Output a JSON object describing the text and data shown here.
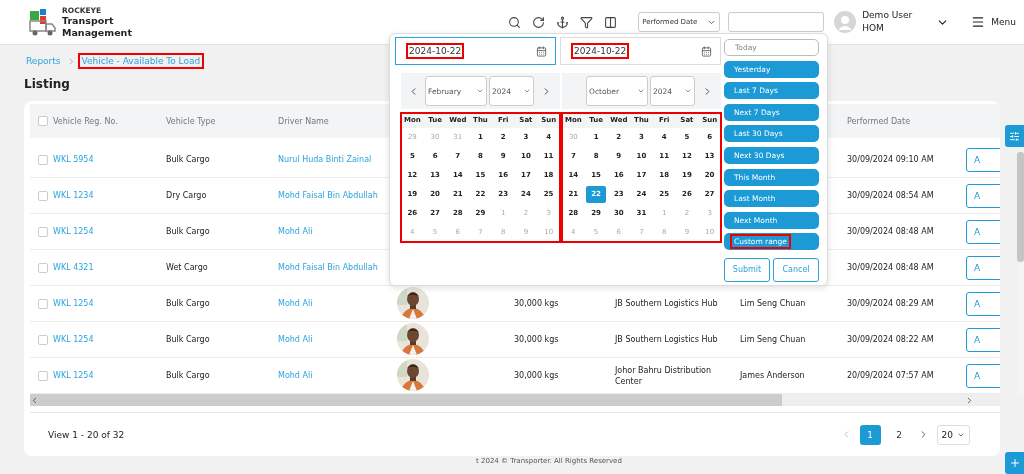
{
  "header": {
    "brand_small": "ROCKEYE",
    "brand": "Transport Management",
    "date_select": "Performed Date",
    "user": {
      "name": "Demo User",
      "role": "HOM"
    },
    "menu_label": "Menu"
  },
  "breadcrumb": [
    {
      "label": "Reports",
      "highlighted": false
    },
    {
      "label": "Vehicle - Available To Load",
      "highlighted": true
    }
  ],
  "page_title": "Listing",
  "table": {
    "select_all_checked": false,
    "header": {
      "reg": "Vehicle Reg. No.",
      "type": "Vehicle Type",
      "driver": "Driver Name",
      "performed_date": "Performed Date"
    },
    "rows": [
      {
        "checked": false,
        "reg": "WKL 5954",
        "type": "Bulk Cargo",
        "driver": "Nurul Huda Binti Zainal",
        "performed_date": "30/09/2024 09:10 AM",
        "action": "A"
      },
      {
        "checked": false,
        "reg": "WKL 1234",
        "type": "Dry Cargo",
        "driver": "Mohd Faisal Bin Abdullah",
        "performed_date": "30/09/2024 08:54 AM",
        "action": "A"
      },
      {
        "checked": false,
        "reg": "WKL 1254",
        "type": "Bulk Cargo",
        "driver": "Mohd Ali",
        "performed_date": "30/09/2024 08:48 AM",
        "action": "A"
      },
      {
        "checked": false,
        "reg": "WKL 4321",
        "type": "Wet Cargo",
        "driver": "Mohd Faisal Bin Abdullah",
        "performed_date": "30/09/2024 08:48 AM",
        "action": "A"
      },
      {
        "checked": false,
        "reg": "WKL 1254",
        "type": "Bulk Cargo",
        "driver": "Mohd Ali",
        "weight": "30,000 kgs",
        "location": "JB Southern Logistics Hub",
        "person": "Lim Seng Chuan",
        "performed_date": "30/09/2024 08:29 AM",
        "action": "A"
      },
      {
        "checked": false,
        "reg": "WKL 1254",
        "type": "Bulk Cargo",
        "driver": "Mohd Ali",
        "weight": "30,000 kgs",
        "location": "JB Southern Logistics Hub",
        "person": "Lim Seng Chuan",
        "performed_date": "30/09/2024 08:22 AM",
        "action": "A"
      },
      {
        "checked": false,
        "reg": "WKL 1254",
        "type": "Bulk Cargo",
        "driver": "Mohd Ali",
        "weight": "30,000 kgs",
        "location": "Johor Bahru Distribution Center",
        "person": "James Anderson",
        "performed_date": "20/09/2024 07:57 AM",
        "action": "A"
      }
    ]
  },
  "footer": {
    "view_text": "View 1 - 20 of 32",
    "pages": [
      {
        "label": "1",
        "selected": true
      },
      {
        "label": "2",
        "selected": false
      }
    ],
    "page_size": "20"
  },
  "copyright": "t 2024 © Transporter. All Rights Reserved",
  "date_picker": {
    "start_date": {
      "value": "2024-10-22",
      "focused": true,
      "highlighted": true
    },
    "end_date": {
      "value": "2024-10-22",
      "focused": false,
      "highlighted": true
    },
    "calendars": [
      {
        "month": "February",
        "year": "2024",
        "show_prev": true,
        "highlighted": true,
        "weekdays": [
          "Mon",
          "Tue",
          "Wed",
          "Thu",
          "Fri",
          "Sat",
          "Sun"
        ],
        "weeks": [
          [
            {
              "label": "29",
              "other_month": true,
              "selected": false
            },
            {
              "label": "30",
              "other_month": true,
              "selected": false
            },
            {
              "label": "31",
              "other_month": true,
              "selected": false
            },
            {
              "label": "1",
              "other_month": false,
              "selected": false
            },
            {
              "label": "2",
              "other_month": false,
              "selected": false
            },
            {
              "label": "3",
              "other_month": false,
              "selected": false
            },
            {
              "label": "4",
              "other_month": false,
              "selected": false
            }
          ],
          [
            {
              "label": "5",
              "other_month": false,
              "selected": false
            },
            {
              "label": "6",
              "other_month": false,
              "selected": false
            },
            {
              "label": "7",
              "other_month": false,
              "selected": false
            },
            {
              "label": "8",
              "other_month": false,
              "selected": false
            },
            {
              "label": "9",
              "other_month": false,
              "selected": false
            },
            {
              "label": "10",
              "other_month": false,
              "selected": false
            },
            {
              "label": "11",
              "other_month": false,
              "selected": false
            }
          ],
          [
            {
              "label": "12",
              "other_month": false,
              "selected": false
            },
            {
              "label": "13",
              "other_month": false,
              "selected": false
            },
            {
              "label": "14",
              "other_month": false,
              "selected": false
            },
            {
              "label": "15",
              "other_month": false,
              "selected": false
            },
            {
              "label": "16",
              "other_month": false,
              "selected": false
            },
            {
              "label": "17",
              "other_month": false,
              "selected": false
            },
            {
              "label": "18",
              "other_month": false,
              "selected": false
            }
          ],
          [
            {
              "label": "19",
              "other_month": false,
              "selected": false
            },
            {
              "label": "20",
              "other_month": false,
              "selected": false
            },
            {
              "label": "21",
              "other_month": false,
              "selected": false
            },
            {
              "label": "22",
              "other_month": false,
              "selected": false
            },
            {
              "label": "23",
              "other_month": false,
              "selected": false
            },
            {
              "label": "24",
              "other_month": false,
              "selected": false
            },
            {
              "label": "25",
              "other_month": false,
              "selected": false
            }
          ],
          [
            {
              "label": "26",
              "other_month": false,
              "selected": false
            },
            {
              "label": "27",
              "other_month": false,
              "selected": false
            },
            {
              "label": "28",
              "other_month": false,
              "selected": false
            },
            {
              "label": "29",
              "other_month": false,
              "selected": false
            },
            {
              "label": "1",
              "other_month": true,
              "selected": false
            },
            {
              "label": "2",
              "other_month": true,
              "selected": false
            },
            {
              "label": "3",
              "other_month": true,
              "selected": false
            }
          ],
          [
            {
              "label": "4",
              "other_month": true,
              "selected": false
            },
            {
              "label": "5",
              "other_month": true,
              "selected": false
            },
            {
              "label": "6",
              "other_month": true,
              "selected": false
            },
            {
              "label": "7",
              "other_month": true,
              "selected": false
            },
            {
              "label": "8",
              "other_month": true,
              "selected": false
            },
            {
              "label": "9",
              "other_month": true,
              "selected": false
            },
            {
              "label": "10",
              "other_month": true,
              "selected": false
            }
          ]
        ]
      },
      {
        "month": "October",
        "year": "2024",
        "show_prev": false,
        "highlighted": true,
        "weekdays": [
          "Mon",
          "Tue",
          "Wed",
          "Thu",
          "Fri",
          "Sat",
          "Sun"
        ],
        "weeks": [
          [
            {
              "label": "30",
              "other_month": true,
              "selected": false
            },
            {
              "label": "1",
              "other_month": false,
              "selected": false
            },
            {
              "label": "2",
              "other_month": false,
              "selected": false
            },
            {
              "label": "3",
              "other_month": false,
              "selected": false
            },
            {
              "label": "4",
              "other_month": false,
              "selected": false
            },
            {
              "label": "5",
              "other_month": false,
              "selected": false
            },
            {
              "label": "6",
              "other_month": false,
              "selected": false
            }
          ],
          [
            {
              "label": "7",
              "other_month": false,
              "selected": false
            },
            {
              "label": "8",
              "other_month": false,
              "selected": false
            },
            {
              "label": "9",
              "other_month": false,
              "selected": false
            },
            {
              "label": "10",
              "other_month": false,
              "selected": false
            },
            {
              "label": "11",
              "other_month": false,
              "selected": false
            },
            {
              "label": "12",
              "other_month": false,
              "selected": false
            },
            {
              "label": "13",
              "other_month": false,
              "selected": false
            }
          ],
          [
            {
              "label": "14",
              "other_month": false,
              "selected": false
            },
            {
              "label": "15",
              "other_month": false,
              "selected": false
            },
            {
              "label": "16",
              "other_month": false,
              "selected": false
            },
            {
              "label": "17",
              "other_month": false,
              "selected": false
            },
            {
              "label": "18",
              "other_month": false,
              "selected": false
            },
            {
              "label": "19",
              "other_month": false,
              "selected": false
            },
            {
              "label": "20",
              "other_month": false,
              "selected": false
            }
          ],
          [
            {
              "label": "21",
              "other_month": false,
              "selected": false
            },
            {
              "label": "22",
              "other_month": false,
              "selected": true
            },
            {
              "label": "23",
              "other_month": false,
              "selected": false
            },
            {
              "label": "24",
              "other_month": false,
              "selected": false
            },
            {
              "label": "25",
              "other_month": false,
              "selected": false
            },
            {
              "label": "26",
              "other_month": false,
              "selected": false
            },
            {
              "label": "27",
              "other_month": false,
              "selected": false
            }
          ],
          [
            {
              "label": "28",
              "other_month": false,
              "selected": false
            },
            {
              "label": "29",
              "other_month": false,
              "selected": false
            },
            {
              "label": "30",
              "other_month": false,
              "selected": false
            },
            {
              "label": "31",
              "other_month": false,
              "selected": false
            },
            {
              "label": "1",
              "other_month": true,
              "selected": false
            },
            {
              "label": "2",
              "other_month": true,
              "selected": false
            },
            {
              "label": "3",
              "other_month": true,
              "selected": false
            }
          ],
          [
            {
              "label": "4",
              "other_month": true,
              "selected": false
            },
            {
              "label": "5",
              "other_month": true,
              "selected": false
            },
            {
              "label": "6",
              "other_month": true,
              "selected": false
            },
            {
              "label": "7",
              "other_month": true,
              "selected": false
            },
            {
              "label": "8",
              "other_month": true,
              "selected": false
            },
            {
              "label": "9",
              "other_month": true,
              "selected": false
            },
            {
              "label": "10",
              "other_month": true,
              "selected": false
            }
          ]
        ]
      }
    ],
    "ranges": [
      {
        "label": "Today",
        "kind": "outline",
        "highlighted": false
      },
      {
        "label": "Yesterday",
        "kind": "filled",
        "highlighted": false
      },
      {
        "label": "Last 7 Days",
        "kind": "filled",
        "highlighted": false
      },
      {
        "label": "Next 7 Days",
        "kind": "filled",
        "highlighted": false
      },
      {
        "label": "Last 30 Days",
        "kind": "filled",
        "highlighted": false
      },
      {
        "label": "Next 30 Days",
        "kind": "filled",
        "highlighted": false
      },
      {
        "label": "This Month",
        "kind": "filled",
        "highlighted": false
      },
      {
        "label": "Last Month",
        "kind": "filled",
        "highlighted": false
      },
      {
        "label": "Next Month",
        "kind": "filled",
        "highlighted": false
      },
      {
        "label": "Custom range",
        "kind": "filled",
        "highlighted": true
      }
    ],
    "buttons": [
      "Submit",
      "Cancel"
    ]
  }
}
